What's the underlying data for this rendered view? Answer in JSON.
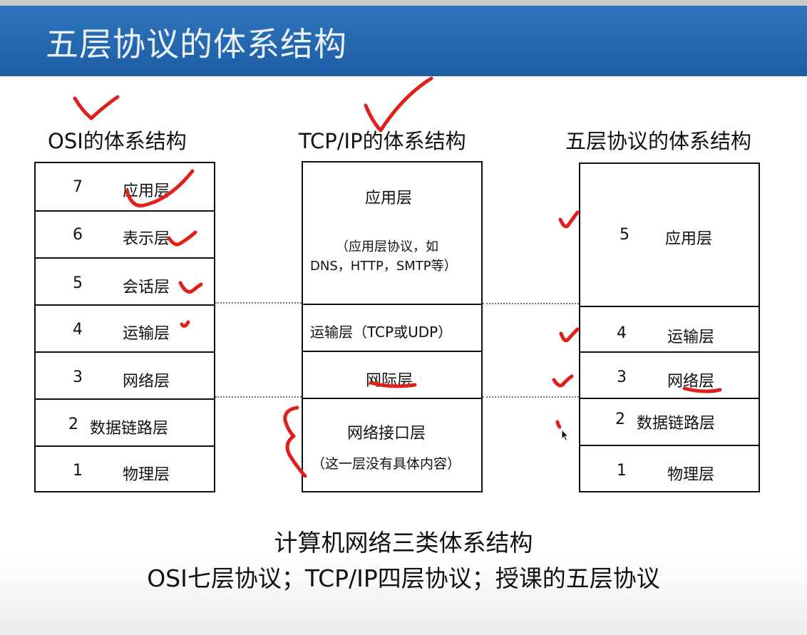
{
  "slide": {
    "title": "五层协议的体系结构"
  },
  "columns": {
    "osi": {
      "title": "OSI的体系结构",
      "layers": [
        {
          "num": "7",
          "name": "应用层"
        },
        {
          "num": "6",
          "name": "表示层"
        },
        {
          "num": "5",
          "name": "会话层"
        },
        {
          "num": "4",
          "name": "运输层"
        },
        {
          "num": "3",
          "name": "网络层"
        },
        {
          "num": "2",
          "name": "数据链路层"
        },
        {
          "num": "1",
          "name": "物理层"
        }
      ]
    },
    "tcpip": {
      "title": "TCP/IP的体系结构",
      "layers": [
        {
          "name": "应用层",
          "note_line1": "（应用层协议，如",
          "note_line2": "DNS，HTTP，SMTP等）"
        },
        {
          "name": "运输层（TCP或UDP）"
        },
        {
          "name": "网际层"
        },
        {
          "name": "网络接口层",
          "note": "（这一层没有具体内容）"
        }
      ]
    },
    "five": {
      "title": "五层协议的体系结构",
      "layers": [
        {
          "num": "5",
          "name": "应用层"
        },
        {
          "num": "4",
          "name": "运输层"
        },
        {
          "num": "3",
          "name": "网络层"
        },
        {
          "num": "2",
          "name": "数据链路层"
        },
        {
          "num": "1",
          "name": "物理层"
        }
      ]
    }
  },
  "caption": {
    "line1": "计算机网络三类体系结构",
    "line2": "OSI七层协议；TCP/IP四层协议；授课的五层协议"
  },
  "colors": {
    "header": "#1d5ea5",
    "annotation": "#e0201b"
  }
}
